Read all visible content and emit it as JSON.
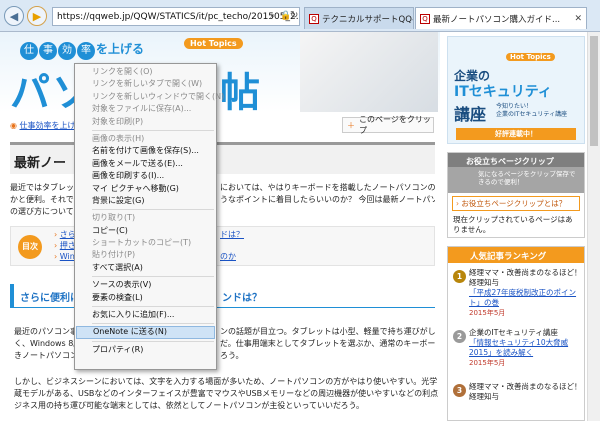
{
  "browser": {
    "url": "https://qqweb.jp/QQW/STATICS/it/pc_techo/201505_2...",
    "tabs": [
      "テクニカルサポートQQ-Web あ...",
      "最新ノートパソコン購入ガイド..."
    ]
  },
  "banner": {
    "title_main": "仕事効率を上げる",
    "circle_chars": [
      "仕",
      "事",
      "効",
      "率"
    ],
    "suffix": "を上げる",
    "hot_topics": "Hot Topics",
    "big": "パソコン手帖"
  },
  "breadcrumb": "仕事効率を上げ",
  "clip_button": "このページをクリップ",
  "article": {
    "heading": "最新ノー",
    "p1_left": "最近ではタブレッ",
    "p1_right": "においては、やはりキーボードを搭載したノートパソコンの方が何",
    "p2_left": "かと便利。それで",
    "p2_right": "うなポイントに着目したらいいのか？ 今回は最新ノートパソコン",
    "p3_left": "の選び方について",
    "toc_label": "目次",
    "toc_links": [
      "さら",
      "押さ",
      "Win"
    ],
    "toc_right": [
      "ドは？",
      "",
      "のか"
    ],
    "section2": "さらに便利に",
    "section2_right": "ンドは？",
    "body1": "最近のパソコン事",
    "body1_r": "ンの話題が目立つ。タブレットは小型、軽量で持ち運びがしやす",
    "body2": "く、Windows 8/",
    "body2_r": "だ。仕事用端末としてタブレットを選ぶか、通常のキーボード付",
    "body3": "きノートパソコン",
    "body3_r": "ろう。",
    "body4": "しかし、ビジネスシーンにおいては、文字を入力する場面が多いため、ノートパソコンの方がやはり使いやすい。光学ドライブ内",
    "body5": "蔵モデルがある、USBなどのインターフェイスが豊富でマウスやUSBメモリーなどの周辺機器が使いやすいなどの利点もある。ビ",
    "body6": "ジネス用の持ち運び可能な端末としては、依然としてノートパソコンが主役といっていいだろう。"
  },
  "side_ad": {
    "hot": "Hot Topics",
    "line1": "企業の",
    "line2": "ITセキュリティ",
    "line3": "講座",
    "tagline1": "今知りたい！",
    "tagline2": "企業のITセキュリティ講座",
    "button": "好評連載中！"
  },
  "clip_box": {
    "title": "お役立ちページクリップ",
    "desc": "気になるページをクリップ保存できるので便利！",
    "link": "お役立ちページクリップとは？",
    "empty": "現在クリップされているページはありません。"
  },
  "ranking": {
    "title": "人気記事ランキング",
    "items": [
      {
        "num": "1",
        "text": "経理ママ・改善尚まのなるほど！経理知与",
        "sub": "「平成27年度税制改正のポイント」の巻",
        "date": "2015年5月"
      },
      {
        "num": "2",
        "text": "企業のITセキュリティ講座",
        "sub": "「情報セキュリティ10大脅威2015」を読み解く",
        "date": "2015年5月"
      },
      {
        "num": "3",
        "text": "経理ママ・改善尚まのなるほど！経理知与",
        "sub": "",
        "date": ""
      }
    ]
  },
  "menu": {
    "items": [
      {
        "label": "リンクを開く(O)",
        "disabled": true
      },
      {
        "label": "リンクを新しいタブで開く(W)",
        "disabled": true
      },
      {
        "label": "リンクを新しいウィンドウで開く(N)",
        "disabled": true
      },
      {
        "label": "対象をファイルに保存(A)...",
        "disabled": true
      },
      {
        "label": "対象を印刷(P)",
        "disabled": true
      },
      {
        "sep": true
      },
      {
        "label": "画像の表示(H)",
        "disabled": true
      },
      {
        "label": "名前を付けて画像を保存(S)..."
      },
      {
        "label": "画像をメールで送る(E)..."
      },
      {
        "label": "画像を印刷する(I)..."
      },
      {
        "label": "マイ ピクチャへ移動(G)"
      },
      {
        "label": "背景に設定(G)"
      },
      {
        "sep": true
      },
      {
        "label": "切り取り(T)",
        "disabled": true
      },
      {
        "label": "コピー(C)"
      },
      {
        "label": "ショートカットのコピー(T)",
        "disabled": true
      },
      {
        "label": "貼り付け(P)",
        "disabled": true
      },
      {
        "label": "すべて選択(A)"
      },
      {
        "sep": true
      },
      {
        "label": "ソースの表示(V)"
      },
      {
        "label": "要素の検査(L)"
      },
      {
        "sep": true
      },
      {
        "label": "お気に入りに追加(F)..."
      },
      {
        "sep": true
      },
      {
        "label": "OneNote に送る(N)",
        "highlight": true
      },
      {
        "sep": true
      },
      {
        "label": "プロパティ(R)"
      }
    ]
  }
}
